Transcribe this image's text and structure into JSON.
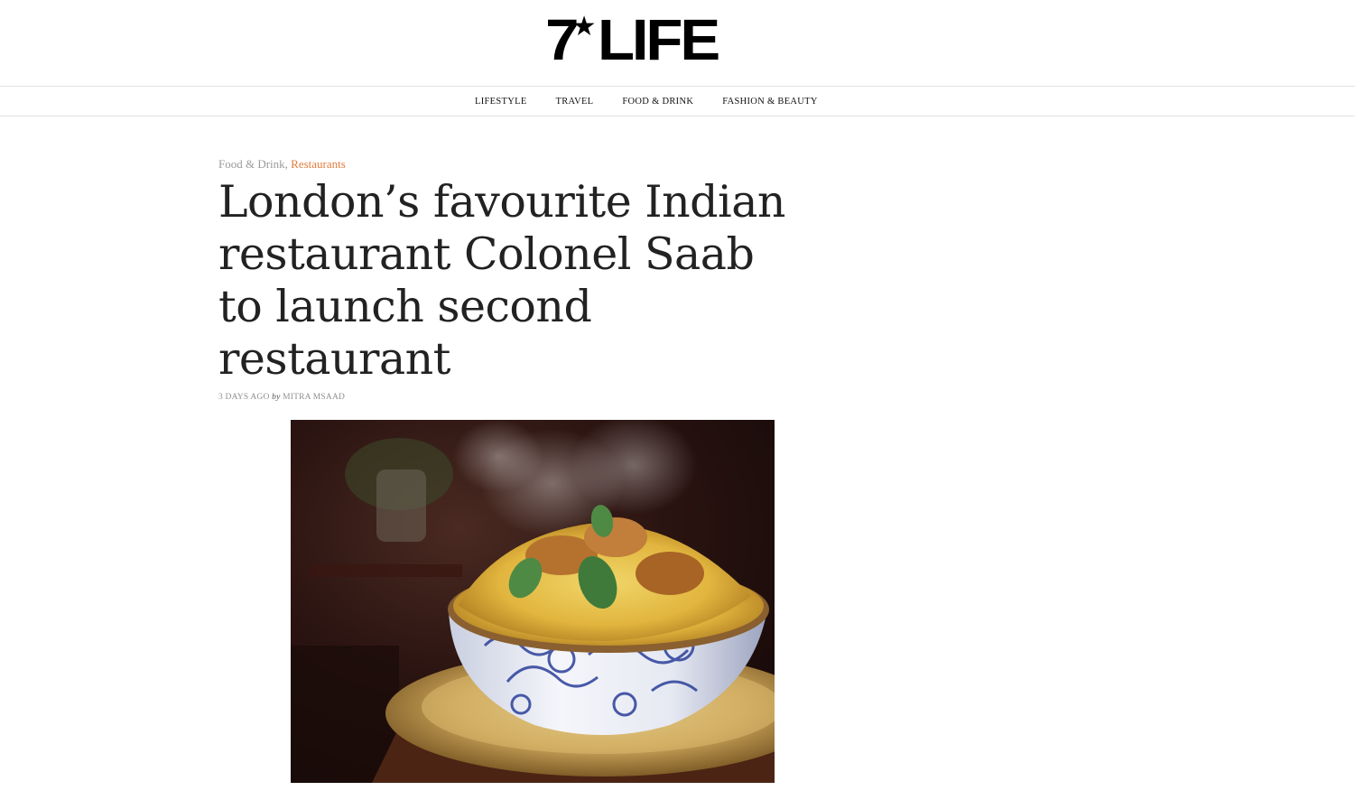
{
  "header": {
    "logo": {
      "seven": "7",
      "star": "★",
      "life": "LIFE"
    }
  },
  "nav": {
    "items": [
      {
        "label": "LIFESTYLE"
      },
      {
        "label": "TRAVEL"
      },
      {
        "label": "FOOD & DRINK"
      },
      {
        "label": "FASHION & BEAUTY"
      }
    ]
  },
  "article": {
    "categories": {
      "primary": "Food & Drink",
      "separator": ",",
      "secondary": "Restaurants"
    },
    "headline": "London’s favourite Indian restaurant Colonel Saab to launch second restaurant",
    "meta": {
      "date": "3 DAYS AGO",
      "by": "by",
      "author": "MITRA MSAAD"
    },
    "hero_image": {
      "subject": "biryani-bowl-photo"
    }
  },
  "colors": {
    "accent": "#e07b3a",
    "muted": "#9a9a9a",
    "text": "#222222",
    "divider": "#e2e2e2"
  }
}
